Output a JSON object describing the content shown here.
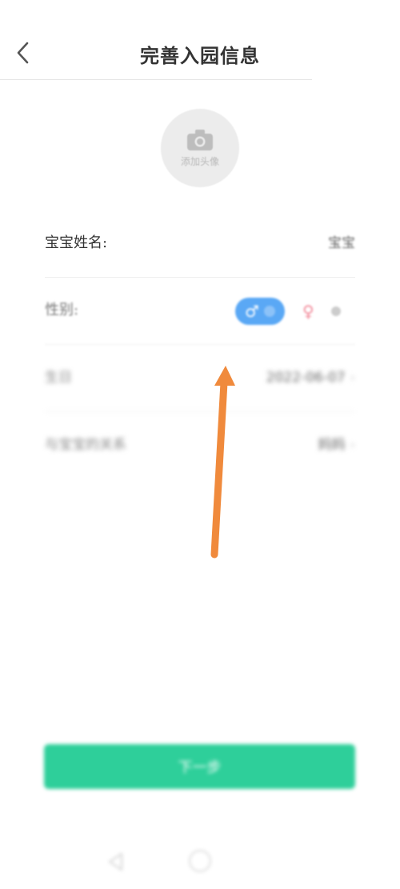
{
  "header": {
    "title": "完善入园信息",
    "back_icon": "chevron-left-icon"
  },
  "avatar": {
    "label": "添加头像",
    "icon": "camera-icon"
  },
  "form": {
    "name": {
      "label": "宝宝姓名:",
      "value": "宝宝"
    },
    "gender": {
      "label": "性别:",
      "male_symbol": "♂",
      "female_symbol": "♀",
      "selected": "male"
    },
    "birthday": {
      "label": "生日",
      "value": "2022-06-07"
    },
    "relation": {
      "label": "与宝宝的关系",
      "value": "妈妈"
    }
  },
  "next_button": {
    "label": "下一步"
  },
  "colors": {
    "accent_green": "#2ecf9a",
    "male_blue": "#5aa8f5",
    "female_red": "#f28a9a",
    "annotation_arrow": "#f08a3c"
  }
}
